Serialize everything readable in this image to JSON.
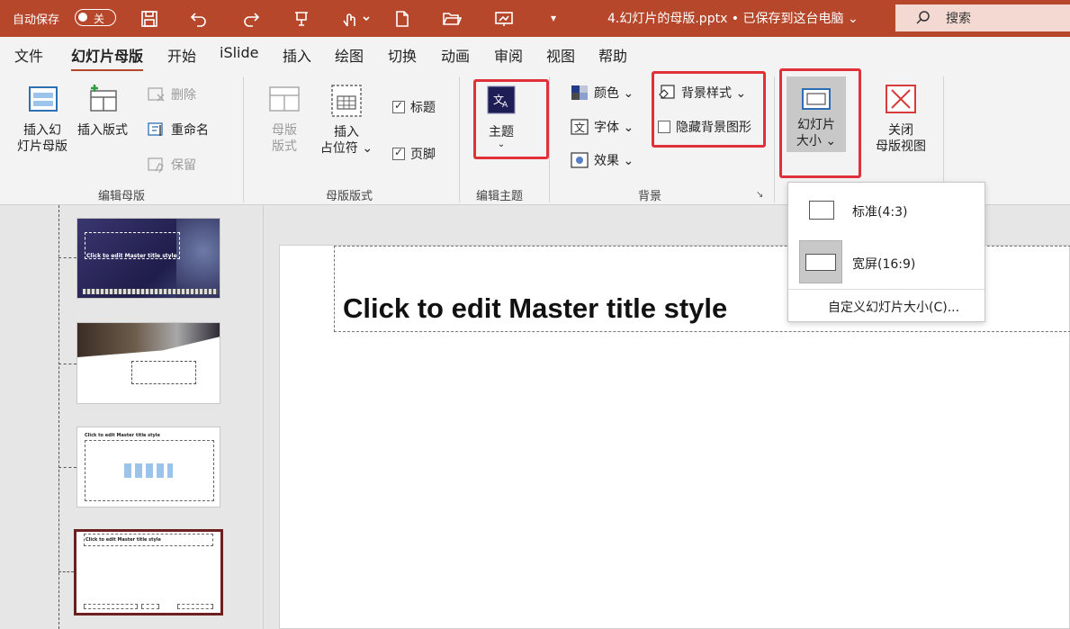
{
  "titlebar": {
    "autosave_label": "自动保存",
    "autosave_state": "关",
    "filename": "4.幻灯片的母版.pptx • 已保存到这台电脑 ⌄",
    "search_placeholder": "搜索",
    "accent": "#b7472a"
  },
  "tabs": [
    "文件",
    "幻灯片母版",
    "开始",
    "iSlide",
    "插入",
    "绘图",
    "切换",
    "动画",
    "审阅",
    "视图",
    "帮助"
  ],
  "active_tab": "幻灯片母版",
  "ribbon": {
    "edit_master": {
      "insert_master": "插入幻\n灯片母版",
      "insert_layout": "插入版式",
      "delete": "删除",
      "rename": "重命名",
      "preserve": "保留",
      "group_label": "编辑母版"
    },
    "master_layout": {
      "master_layout_btn": "母版\n版式",
      "insert_placeholder": "插入\n占位符 ⌄",
      "title_check": "标题",
      "footer_check": "页脚",
      "group_label": "母版版式"
    },
    "edit_theme": {
      "theme": "主题",
      "group_label": "编辑主题"
    },
    "background": {
      "colors": "颜色 ⌄",
      "fonts": "字体 ⌄",
      "effects": "效果 ⌄",
      "bg_styles": "背景样式 ⌄",
      "hide_bg": "隐藏背景图形",
      "group_label": "背景"
    },
    "size": {
      "slide_size": "幻灯片\n大小 ⌄",
      "close_master": "关闭\n母版视图"
    }
  },
  "dropdown": {
    "standard": "标准(4:3)",
    "widescreen": "宽屏(16:9)",
    "custom": "自定义幻灯片大小(C)..."
  },
  "slide": {
    "title": "Click to edit Master title style"
  },
  "thumbnails": {
    "title_text": "Click to edit Master title style"
  }
}
